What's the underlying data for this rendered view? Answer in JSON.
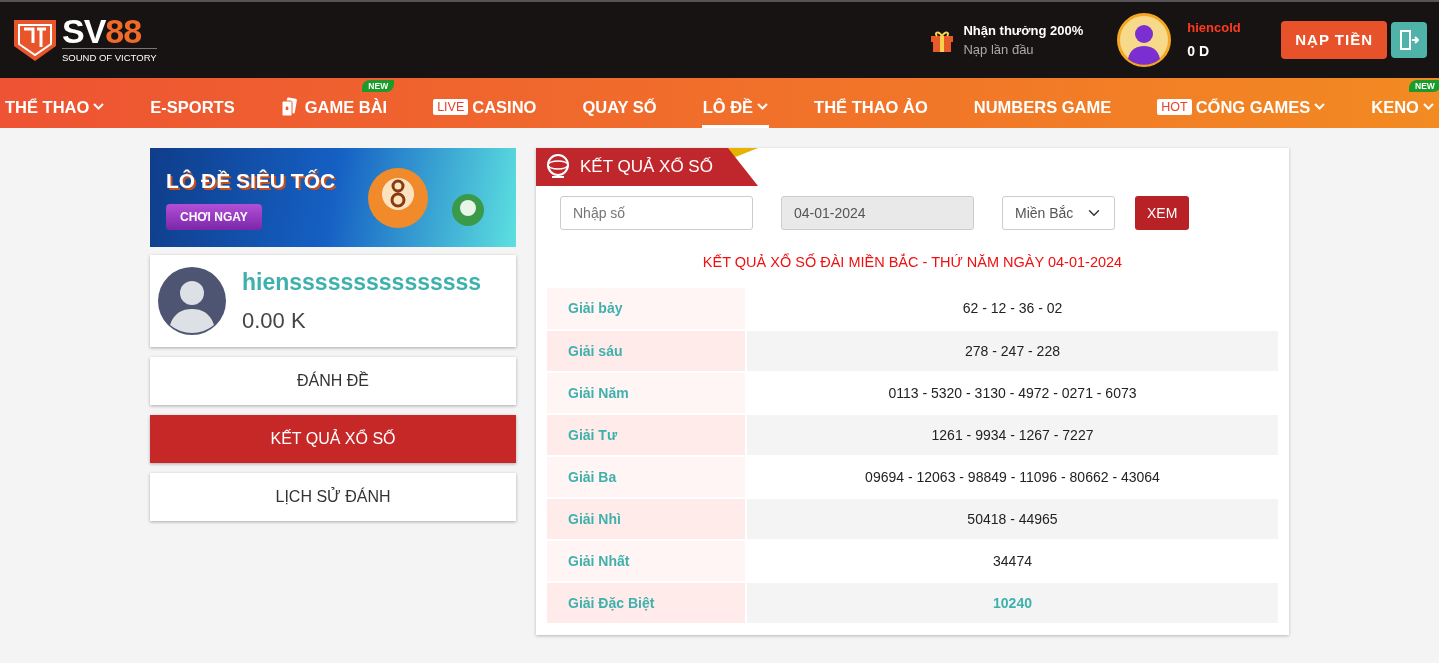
{
  "header": {
    "logo": {
      "brand_parts": [
        "SV",
        "88"
      ],
      "tagline": "SOUND OF VICTORY"
    },
    "promo": {
      "title": "Nhận thưởng 200%",
      "subtitle": "Nạp lần đầu"
    },
    "user": {
      "name": "hiencold",
      "balance": "0 D"
    },
    "deposit_button": "NẠP TIỀN"
  },
  "nav": [
    {
      "label": "THỂ THAO",
      "caret": true,
      "selected": false
    },
    {
      "label": "E-SPORTS",
      "caret": false,
      "selected": false
    },
    {
      "label": "GAME BÀI",
      "caret": false,
      "selected": false,
      "kind": "cards",
      "badge": "NEW"
    },
    {
      "label": "CASINO",
      "caret": false,
      "selected": false,
      "tag": "LIVE"
    },
    {
      "label": "QUAY SỐ",
      "caret": false,
      "selected": false
    },
    {
      "label": "LÔ ĐỀ",
      "caret": true,
      "selected": true
    },
    {
      "label": "THỂ THAO ẢO",
      "caret": false,
      "selected": false
    },
    {
      "label": "NUMBERS GAME",
      "caret": false,
      "selected": false
    },
    {
      "label": "CỔNG GAMES",
      "caret": true,
      "selected": false,
      "tag": "HOT"
    },
    {
      "label": "KENO",
      "caret": true,
      "selected": false,
      "badge": "NEW"
    }
  ],
  "sidebar": {
    "banner": {
      "title": "LÔ ĐỀ SIÊU TỐC",
      "button": "CHƠI NGAY"
    },
    "profile": {
      "name": "hiensssssssssssssss",
      "balance": "0.00 K"
    },
    "menu": [
      {
        "label": "ĐÁNH ĐỀ",
        "selected": false
      },
      {
        "label": "KẾT QUẢ XỔ SỐ",
        "selected": true
      },
      {
        "label": "LỊCH SỬ ĐÁNH",
        "selected": false
      }
    ]
  },
  "results": {
    "title": "KẾT QUẢ XỔ SỐ",
    "number_field": {
      "placeholder": "Nhập số"
    },
    "date_field": {
      "value": "04-01-2024"
    },
    "region_select": {
      "value": "Miền Bắc"
    },
    "view_button": "XEM",
    "heading": "KẾT QUẢ XỔ SỐ ĐÀI MIỀN BẮC - THỨ NĂM NGÀY 04-01-2024",
    "rows": [
      {
        "label": "Giải bảy",
        "value": "62 - 12 - 36 - 02",
        "highlight": false
      },
      {
        "label": "Giải sáu",
        "value": "278 - 247 - 228",
        "highlight": false
      },
      {
        "label": "Giải Năm",
        "value": "0113 - 5320 - 3130 - 4972 - 0271 - 6073",
        "highlight": false
      },
      {
        "label": "Giải Tư",
        "value": "1261 - 9934 - 1267 - 7227",
        "highlight": false
      },
      {
        "label": "Giải Ba",
        "value": "09694 - 12063 - 98849 - 11096 - 80662 - 43064",
        "highlight": false
      },
      {
        "label": "Giải Nhì",
        "value": "50418 - 44965",
        "highlight": false
      },
      {
        "label": "Giải Nhất",
        "value": "34474",
        "highlight": false
      },
      {
        "label": "Giải Đặc Biệt",
        "value": "10240",
        "highlight": true
      }
    ]
  }
}
